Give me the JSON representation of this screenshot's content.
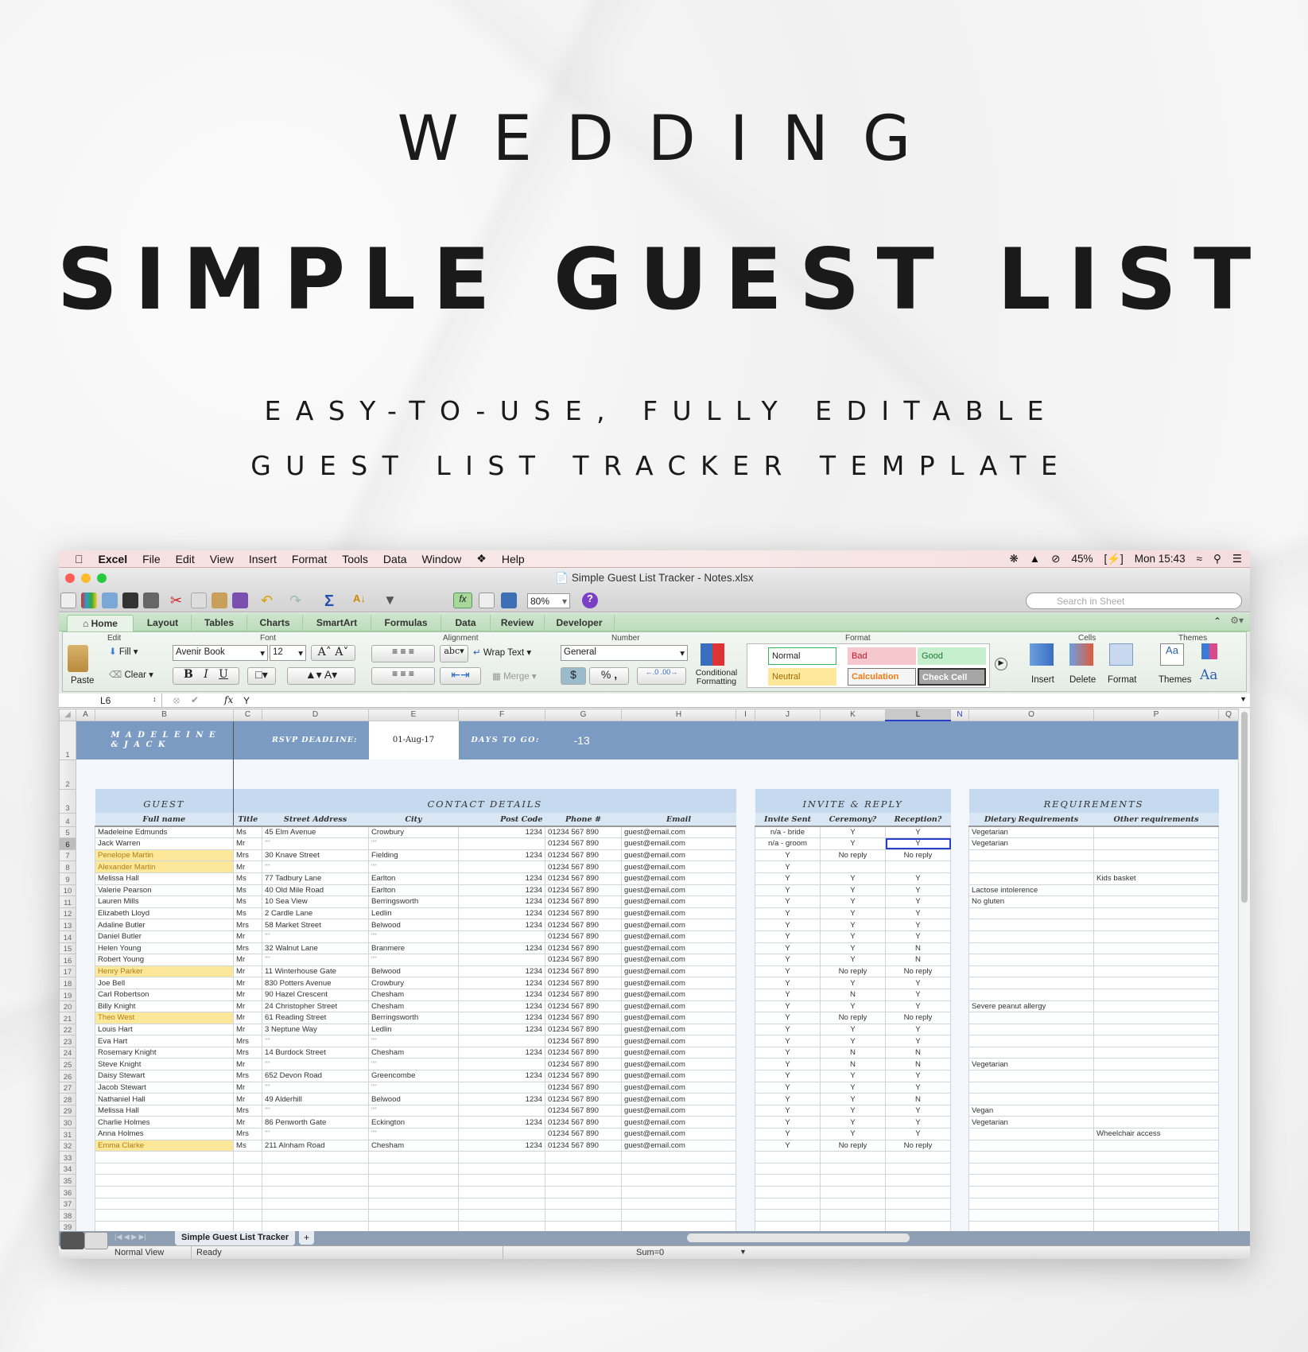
{
  "hero": {
    "line1": "WEDDING",
    "line2": "SIMPLE GUEST LIST",
    "line3": "EASY-TO-USE, FULLY EDITABLE",
    "line4": "GUEST LIST TRACKER TEMPLATE"
  },
  "menubar": {
    "app": "Excel",
    "items": [
      "File",
      "Edit",
      "View",
      "Insert",
      "Format",
      "Tools",
      "Data",
      "Window",
      "Help"
    ],
    "battery": "45%",
    "clock": "Mon 15:43"
  },
  "window": {
    "title": "Simple Guest List Tracker - Notes.xlsx"
  },
  "toolbar": {
    "zoom": "80%",
    "search_placeholder": "Search in Sheet"
  },
  "tabs": [
    "Home",
    "Layout",
    "Tables",
    "Charts",
    "SmartArt",
    "Formulas",
    "Data",
    "Review",
    "Developer"
  ],
  "ribbon": {
    "groups": {
      "edit": "Edit",
      "font": "Font",
      "alignment": "Alignment",
      "number": "Number",
      "format": "Format",
      "cells": "Cells",
      "themes": "Themes"
    },
    "paste": "Paste",
    "fill": "Fill",
    "clear": "Clear",
    "font_name": "Avenir Book",
    "font_size": "12",
    "bold": "B",
    "italic": "I",
    "underline": "U",
    "wrap_text": "Wrap Text",
    "merge": "Merge",
    "abc": "abc",
    "number_format": "General",
    "percent": "%",
    "comma": ",",
    "conditional_formatting": "Conditional Formatting",
    "styles": [
      {
        "label": "Normal",
        "bg": "#ffffff",
        "fg": "#222222",
        "border": "#2fb85a"
      },
      {
        "label": "Bad",
        "bg": "#f7c7ce",
        "fg": "#c0142a",
        "border": "#f7c7ce"
      },
      {
        "label": "Good",
        "bg": "#c6efce",
        "fg": "#1e7a34",
        "border": "#c6efce"
      },
      {
        "label": "Neutral",
        "bg": "#ffe89c",
        "fg": "#9a6a00",
        "border": "#ffe89c"
      },
      {
        "label": "Calculation",
        "bg": "#f5f5f5",
        "fg": "#f07b10",
        "border": "#777777"
      },
      {
        "label": "Check Cell",
        "bg": "#a5a5a5",
        "fg": "#ffffff",
        "border": "#333333"
      }
    ],
    "insert": "Insert",
    "delete": "Delete",
    "format": "Format",
    "themes": "Themes",
    "aa": "Aa"
  },
  "formula_bar": {
    "cell_ref": "L6",
    "fx": "fx",
    "value": "Y"
  },
  "columns": [
    "A",
    "B",
    "C",
    "D",
    "E",
    "F",
    "G",
    "H",
    "I",
    "J",
    "K",
    "L",
    "N",
    "O",
    "P",
    "Q"
  ],
  "sheet": {
    "couple": "M A D E L E I N E",
    "couple2": "& J A C K",
    "rsvp_label": "RSVP DEADLINE:",
    "rsvp_date": "01-Aug-17",
    "days_label": "DAYS TO GO:",
    "days_value": "-13",
    "sections": {
      "guest": "GUEST",
      "contact": "CONTACT DETAILS",
      "invite": "INVITE & REPLY",
      "requirements": "REQUIREMENTS"
    },
    "headers": [
      "Full name",
      "Title",
      "Street Address",
      "City",
      "Post Code",
      "Phone #",
      "Email",
      "Invite Sent",
      "Ceremony?",
      "Reception?",
      "Dietary Requirements",
      "Other requirements"
    ],
    "highlight_color": "#fde89a",
    "band_color": "#7b9bc3",
    "selected_cell": "L6",
    "rows": [
      {
        "n": "5",
        "name": "Madeleine Edmunds",
        "title": "Ms",
        "street": "45 Elm Avenue",
        "city": "Crowbury",
        "post": "1234",
        "phone": "01234 567 890",
        "email": "guest@email.com",
        "invite": "n/a - bride",
        "cer": "Y",
        "rec": "Y",
        "diet": "Vegetarian",
        "other": "",
        "hl": false
      },
      {
        "n": "6",
        "name": "Jack Warren",
        "title": "Mr",
        "street": "\"\"",
        "city": "\"\"",
        "post": "",
        "phone": "01234 567 890",
        "email": "guest@email.com",
        "invite": "n/a - groom",
        "cer": "Y",
        "rec": "Y",
        "diet": "Vegetarian",
        "other": "",
        "hl": false
      },
      {
        "n": "7",
        "name": "Penelope Martin",
        "title": "Mrs",
        "street": "30 Knave Street",
        "city": "Fielding",
        "post": "1234",
        "phone": "01234 567 890",
        "email": "guest@email.com",
        "invite": "Y",
        "cer": "No reply",
        "rec": "No reply",
        "diet": "",
        "other": "",
        "hl": true
      },
      {
        "n": "8",
        "name": "Alexander Martin",
        "title": "Mr",
        "street": "\"\"",
        "city": "\"\"",
        "post": "",
        "phone": "01234 567 890",
        "email": "guest@email.com",
        "invite": "Y",
        "cer": "",
        "rec": "",
        "diet": "",
        "other": "",
        "hl": true
      },
      {
        "n": "9",
        "name": "Melissa Hall",
        "title": "Ms",
        "street": "77 Tadbury Lane",
        "city": "Earlton",
        "post": "1234",
        "phone": "01234 567 890",
        "email": "guest@email.com",
        "invite": "Y",
        "cer": "Y",
        "rec": "Y",
        "diet": "",
        "other": "Kids basket",
        "hl": false
      },
      {
        "n": "10",
        "name": "Valerie Pearson",
        "title": "Ms",
        "street": "40 Old Mile Road",
        "city": "Earlton",
        "post": "1234",
        "phone": "01234 567 890",
        "email": "guest@email.com",
        "invite": "Y",
        "cer": "Y",
        "rec": "Y",
        "diet": "Lactose intolerence",
        "other": "",
        "hl": false
      },
      {
        "n": "11",
        "name": "Lauren Mills",
        "title": "Ms",
        "street": "10 Sea View",
        "city": "Berringsworth",
        "post": "1234",
        "phone": "01234 567 890",
        "email": "guest@email.com",
        "invite": "Y",
        "cer": "Y",
        "rec": "Y",
        "diet": "No gluten",
        "other": "",
        "hl": false
      },
      {
        "n": "12",
        "name": "Elizabeth Lloyd",
        "title": "Ms",
        "street": "2 Cardle Lane",
        "city": "Ledlin",
        "post": "1234",
        "phone": "01234 567 890",
        "email": "guest@email.com",
        "invite": "Y",
        "cer": "Y",
        "rec": "Y",
        "diet": "",
        "other": "",
        "hl": false
      },
      {
        "n": "13",
        "name": "Adaline Butler",
        "title": "Mrs",
        "street": "58 Market Street",
        "city": "Belwood",
        "post": "1234",
        "phone": "01234 567 890",
        "email": "guest@email.com",
        "invite": "Y",
        "cer": "Y",
        "rec": "Y",
        "diet": "",
        "other": "",
        "hl": false
      },
      {
        "n": "14",
        "name": "Daniel Butler",
        "title": "Mr",
        "street": "\"\"",
        "city": "\"\"",
        "post": "",
        "phone": "01234 567 890",
        "email": "guest@email.com",
        "invite": "Y",
        "cer": "Y",
        "rec": "Y",
        "diet": "",
        "other": "",
        "hl": false
      },
      {
        "n": "15",
        "name": "Helen Young",
        "title": "Mrs",
        "street": "32 Walnut Lane",
        "city": "Branmere",
        "post": "1234",
        "phone": "01234 567 890",
        "email": "guest@email.com",
        "invite": "Y",
        "cer": "Y",
        "rec": "N",
        "diet": "",
        "other": "",
        "hl": false
      },
      {
        "n": "16",
        "name": "Robert Young",
        "title": "Mr",
        "street": "\"\"",
        "city": "\"\"",
        "post": "",
        "phone": "01234 567 890",
        "email": "guest@email.com",
        "invite": "Y",
        "cer": "Y",
        "rec": "N",
        "diet": "",
        "other": "",
        "hl": false
      },
      {
        "n": "17",
        "name": "Henry Parker",
        "title": "Mr",
        "street": "11 Winterhouse Gate",
        "city": "Belwood",
        "post": "1234",
        "phone": "01234 567 890",
        "email": "guest@email.com",
        "invite": "Y",
        "cer": "No reply",
        "rec": "No reply",
        "diet": "",
        "other": "",
        "hl": true
      },
      {
        "n": "18",
        "name": "Joe Bell",
        "title": "Mr",
        "street": "830 Potters Avenue",
        "city": "Crowbury",
        "post": "1234",
        "phone": "01234 567 890",
        "email": "guest@email.com",
        "invite": "Y",
        "cer": "Y",
        "rec": "Y",
        "diet": "",
        "other": "",
        "hl": false
      },
      {
        "n": "19",
        "name": "Carl Robertson",
        "title": "Mr",
        "street": "90 Hazel Crescent",
        "city": "Chesham",
        "post": "1234",
        "phone": "01234 567 890",
        "email": "guest@email.com",
        "invite": "Y",
        "cer": "N",
        "rec": "Y",
        "diet": "",
        "other": "",
        "hl": false
      },
      {
        "n": "20",
        "name": "Billy Knight",
        "title": "Mr",
        "street": "24 Christopher Street",
        "city": "Chesham",
        "post": "1234",
        "phone": "01234 567 890",
        "email": "guest@email.com",
        "invite": "Y",
        "cer": "Y",
        "rec": "Y",
        "diet": "Severe peanut allergy",
        "other": "",
        "hl": false
      },
      {
        "n": "21",
        "name": "Theo West",
        "title": "Mr",
        "street": "61 Reading Street",
        "city": "Berringsworth",
        "post": "1234",
        "phone": "01234 567 890",
        "email": "guest@email.com",
        "invite": "Y",
        "cer": "No reply",
        "rec": "No reply",
        "diet": "",
        "other": "",
        "hl": true
      },
      {
        "n": "22",
        "name": "Louis Hart",
        "title": "Mr",
        "street": "3 Neptune Way",
        "city": "Ledlin",
        "post": "1234",
        "phone": "01234 567 890",
        "email": "guest@email.com",
        "invite": "Y",
        "cer": "Y",
        "rec": "Y",
        "diet": "",
        "other": "",
        "hl": false
      },
      {
        "n": "23",
        "name": "Eva Hart",
        "title": "Mrs",
        "street": "\"\"",
        "city": "\"\"",
        "post": "",
        "phone": "01234 567 890",
        "email": "guest@email.com",
        "invite": "Y",
        "cer": "Y",
        "rec": "Y",
        "diet": "",
        "other": "",
        "hl": false
      },
      {
        "n": "24",
        "name": "Rosemary Knight",
        "title": "Mrs",
        "street": "14 Burdock Street",
        "city": "Chesham",
        "post": "1234",
        "phone": "01234 567 890",
        "email": "guest@email.com",
        "invite": "Y",
        "cer": "N",
        "rec": "N",
        "diet": "",
        "other": "",
        "hl": false
      },
      {
        "n": "25",
        "name": "Steve Knight",
        "title": "Mr",
        "street": "\"\"",
        "city": "\"\"",
        "post": "",
        "phone": "01234 567 890",
        "email": "guest@email.com",
        "invite": "Y",
        "cer": "N",
        "rec": "N",
        "diet": "Vegetarian",
        "other": "",
        "hl": false
      },
      {
        "n": "26",
        "name": "Daisy Stewart",
        "title": "Mrs",
        "street": "652 Devon Road",
        "city": "Greencombe",
        "post": "1234",
        "phone": "01234 567 890",
        "email": "guest@email.com",
        "invite": "Y",
        "cer": "Y",
        "rec": "Y",
        "diet": "",
        "other": "",
        "hl": false
      },
      {
        "n": "27",
        "name": "Jacob Stewart",
        "title": "Mr",
        "street": "\"\"",
        "city": "\"\"",
        "post": "",
        "phone": "01234 567 890",
        "email": "guest@email.com",
        "invite": "Y",
        "cer": "Y",
        "rec": "Y",
        "diet": "",
        "other": "",
        "hl": false
      },
      {
        "n": "28",
        "name": "Nathaniel Hall",
        "title": "Mr",
        "street": "49 Alderhill",
        "city": "Belwood",
        "post": "1234",
        "phone": "01234 567 890",
        "email": "guest@email.com",
        "invite": "Y",
        "cer": "Y",
        "rec": "N",
        "diet": "",
        "other": "",
        "hl": false
      },
      {
        "n": "29",
        "name": "Melissa Hall",
        "title": "Mrs",
        "street": "\"\"",
        "city": "\"\"",
        "post": "",
        "phone": "01234 567 890",
        "email": "guest@email.com",
        "invite": "Y",
        "cer": "Y",
        "rec": "Y",
        "diet": "Vegan",
        "other": "",
        "hl": false
      },
      {
        "n": "30",
        "name": "Charlie Holmes",
        "title": "Mr",
        "street": "86 Penworth Gate",
        "city": "Eckington",
        "post": "1234",
        "phone": "01234 567 890",
        "email": "guest@email.com",
        "invite": "Y",
        "cer": "Y",
        "rec": "Y",
        "diet": "Vegetarian",
        "other": "",
        "hl": false
      },
      {
        "n": "31",
        "name": "Anna Holmes",
        "title": "Mrs",
        "street": "\"\"",
        "city": "\"\"",
        "post": "",
        "phone": "01234 567 890",
        "email": "guest@email.com",
        "invite": "Y",
        "cer": "Y",
        "rec": "Y",
        "diet": "",
        "other": "Wheelchair access",
        "hl": false
      },
      {
        "n": "32",
        "name": "Emma Clarke",
        "title": "Ms",
        "street": "211 Alnham Road",
        "city": "Chesham",
        "post": "1234",
        "phone": "01234 567 890",
        "email": "guest@email.com",
        "invite": "Y",
        "cer": "No reply",
        "rec": "No reply",
        "diet": "",
        "other": "",
        "hl": true
      }
    ],
    "empty_rows": [
      "33",
      "34",
      "35",
      "36",
      "37",
      "38",
      "39"
    ],
    "row_labels": [
      "1",
      "2",
      "3",
      "4"
    ]
  },
  "sheet_tabs": {
    "active": "Simple Guest List Tracker",
    "add": "+"
  },
  "status": {
    "view": "Normal View",
    "state": "Ready",
    "sum": "Sum=0"
  }
}
